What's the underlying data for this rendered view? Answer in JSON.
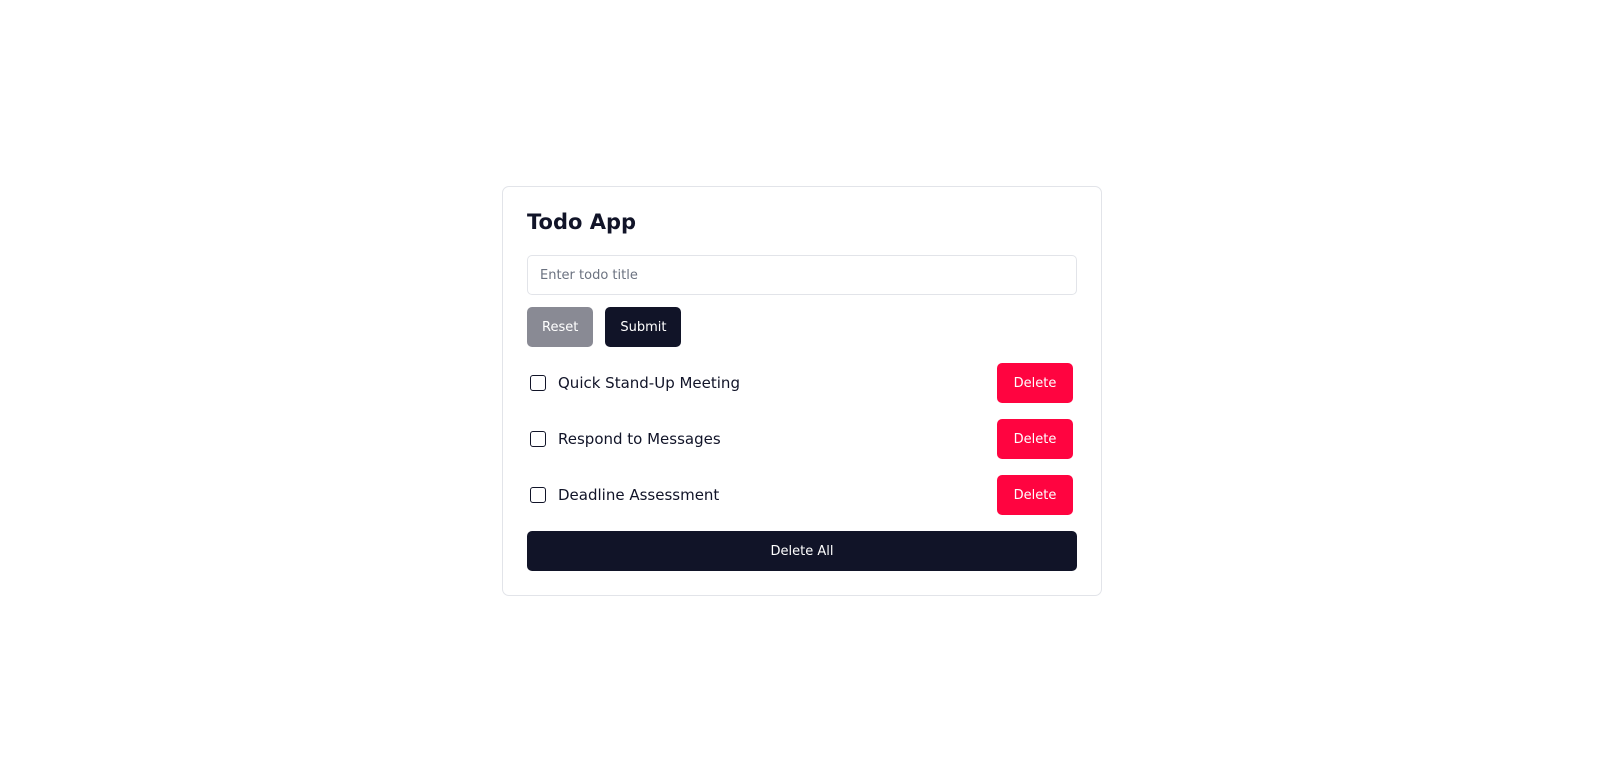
{
  "app": {
    "title": "Todo App"
  },
  "input": {
    "placeholder": "Enter todo title",
    "value": ""
  },
  "buttons": {
    "reset_label": "Reset",
    "submit_label": "Submit",
    "delete_all_label": "Delete All"
  },
  "todos": [
    {
      "title": "Quick Stand-Up Meeting",
      "checked": false,
      "delete_label": "Delete"
    },
    {
      "title": "Respond to Messages",
      "checked": false,
      "delete_label": "Delete"
    },
    {
      "title": "Deadline Assessment",
      "checked": false,
      "delete_label": "Delete"
    }
  ],
  "colors": {
    "primary": "#111428",
    "reset": "#898a94",
    "danger": "#ff0440",
    "border": "#e2e4e9"
  }
}
